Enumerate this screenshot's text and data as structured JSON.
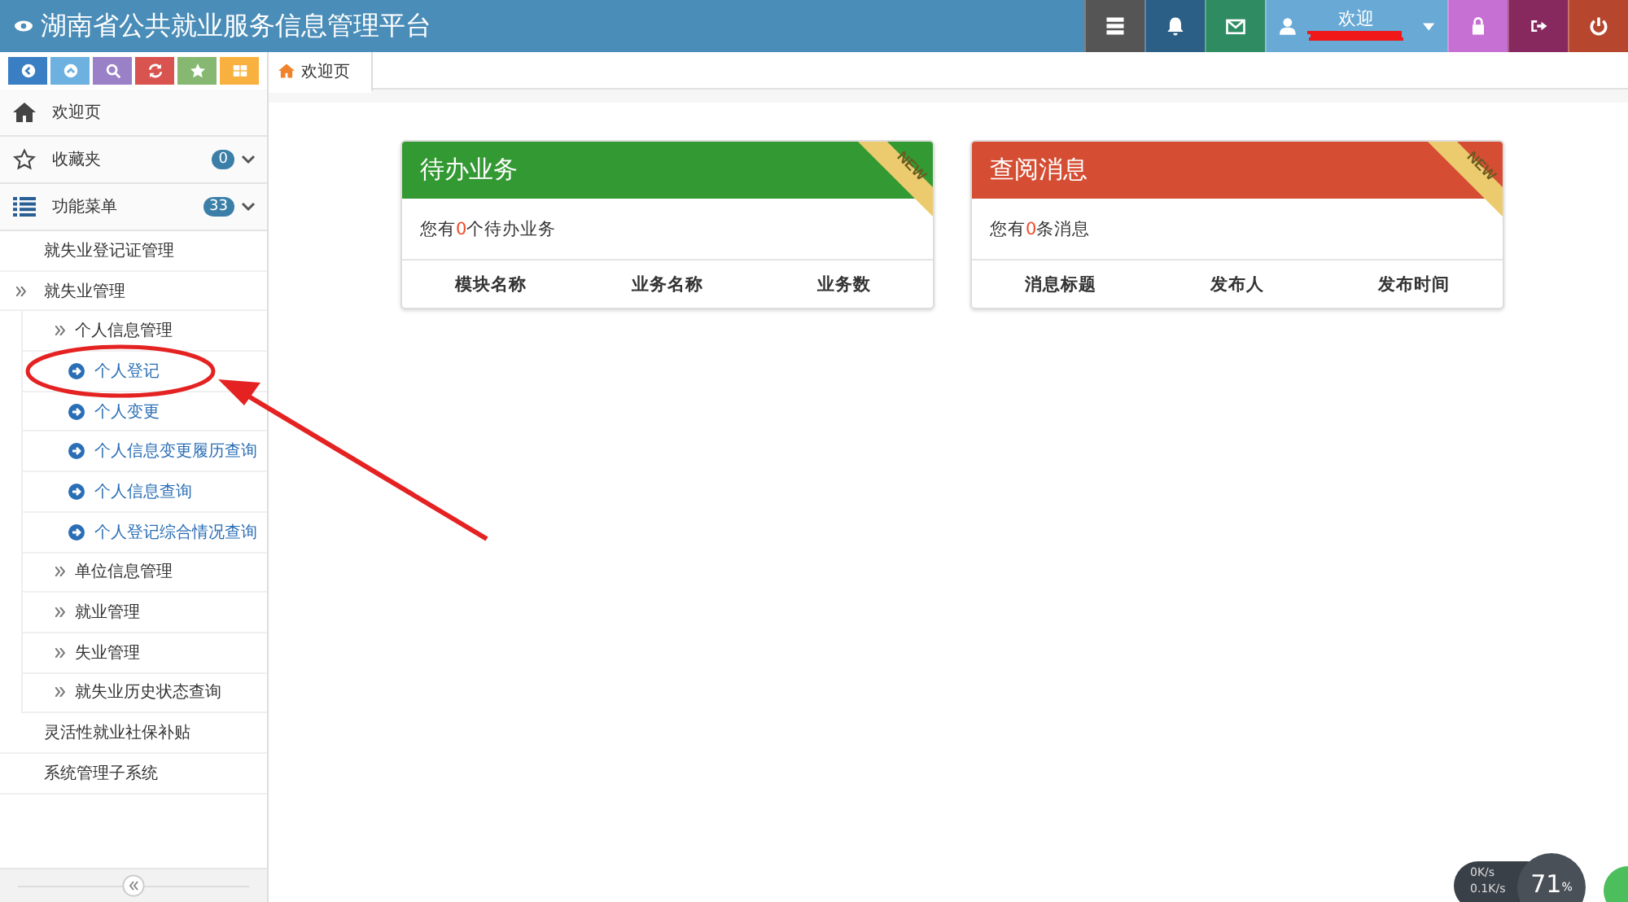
{
  "header": {
    "title": "湖南省公共就业服务信息管理平台",
    "buttons": [
      {
        "kind": "server",
        "color": "#555555"
      },
      {
        "kind": "bell",
        "color": "#2b5f86"
      },
      {
        "kind": "mail",
        "color": "#2e8b62"
      }
    ],
    "user": {
      "greeting": "欢迎",
      "color": "#68a9d5"
    },
    "end_buttons": [
      {
        "kind": "lock",
        "color": "#c770d3"
      },
      {
        "kind": "logout",
        "color": "#87285f"
      },
      {
        "kind": "power",
        "color": "#b6462e"
      }
    ]
  },
  "toolbar": [
    {
      "kind": "back",
      "color": "#3a7fc3"
    },
    {
      "kind": "up",
      "color": "#6cb1e0"
    },
    {
      "kind": "search",
      "color": "#9a80c6"
    },
    {
      "kind": "refresh",
      "color": "#d9534f"
    },
    {
      "kind": "star",
      "color": "#86b871"
    },
    {
      "kind": "grid",
      "color": "#f8b13f"
    }
  ],
  "sidebar": {
    "items": [
      {
        "label": "欢迎页",
        "kind": "home"
      },
      {
        "label": "收藏夹",
        "kind": "star",
        "badge": "0",
        "collapsible": true
      },
      {
        "label": "功能菜单",
        "kind": "list",
        "badge": "33",
        "collapsible": true,
        "children": [
          {
            "label": "就失业登记证管理",
            "kind": "page"
          },
          {
            "label": "就失业管理",
            "kind": "folder",
            "children": [
              {
                "label": "个人信息管理",
                "kind": "folder",
                "children": [
                  {
                    "label": "个人登记",
                    "kind": "link"
                  },
                  {
                    "label": "个人变更",
                    "kind": "link"
                  },
                  {
                    "label": "个人信息变更履历查询",
                    "kind": "link"
                  },
                  {
                    "label": "个人信息查询",
                    "kind": "link"
                  },
                  {
                    "label": "个人登记综合情况查询",
                    "kind": "link"
                  }
                ]
              },
              {
                "label": "单位信息管理",
                "kind": "folder"
              },
              {
                "label": "就业管理",
                "kind": "folder"
              },
              {
                "label": "失业管理",
                "kind": "folder"
              },
              {
                "label": "就失业历史状态查询",
                "kind": "folder"
              }
            ]
          },
          {
            "label": "灵活性就业社保补贴",
            "kind": "page"
          },
          {
            "label": "系统管理子系统",
            "kind": "page"
          }
        ]
      }
    ]
  },
  "tabs": [
    {
      "label": "欢迎页",
      "selected": true
    }
  ],
  "cards": [
    {
      "title": "待办业务",
      "color": "#339933",
      "ribbon": "NEW",
      "message": {
        "before": "您有",
        "count": "0",
        "after": "个待办业务"
      },
      "columns": [
        "模块名称",
        "业务名称",
        "业务数"
      ]
    },
    {
      "title": "查阅消息",
      "color": "#d54e34",
      "ribbon": "NEW",
      "message": {
        "before": "您有",
        "count": "0",
        "after": "条消息"
      },
      "columns": [
        "消息标题",
        "发布人",
        "发布时间"
      ]
    }
  ],
  "monitor": {
    "upload": "0K/s",
    "download": "0.1K/s",
    "percent": "71",
    "unit": "%"
  }
}
